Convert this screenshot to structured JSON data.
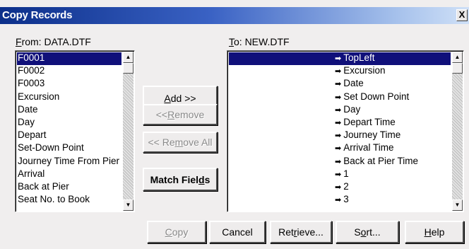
{
  "window": {
    "title": "Copy Records",
    "close_glyph": "X"
  },
  "from": {
    "label_prefix": "",
    "label_mnemonic": "F",
    "label_rest": "rom: DATA.DTF",
    "items": [
      "F0001",
      "F0002",
      "F0003",
      "Excursion",
      "Date",
      "Day",
      "Depart",
      "Set-Down Point",
      "Journey Time From Pier",
      "Arrival",
      "Back at Pier",
      "Seat No. to Book"
    ]
  },
  "to": {
    "label_prefix": "",
    "label_mnemonic": "T",
    "label_rest": "o: NEW.DTF",
    "arrow": "➡",
    "items": [
      "TopLeft",
      "Excursion",
      "Date",
      "Set Down Point",
      "Day",
      "Depart Time",
      "Journey Time",
      "Arrival Time",
      "Back at Pier Time",
      "1",
      "2",
      "3"
    ]
  },
  "scroll": {
    "up": "▲",
    "down": "▼"
  },
  "buttons": {
    "add": {
      "pre": "",
      "mn": "A",
      "post": "dd >>"
    },
    "remove": {
      "pre": "<< ",
      "mn": "R",
      "post": "emove"
    },
    "remove_all": {
      "pre": "<< Re",
      "mn": "m",
      "post": "ove All"
    },
    "match_fields": {
      "pre": "Match Fiel",
      "mn": "d",
      "post": "s"
    },
    "copy": {
      "pre": "",
      "mn": "C",
      "post": "opy"
    },
    "cancel": {
      "pre": "Cancel",
      "mn": "",
      "post": ""
    },
    "retrieve": {
      "pre": "Ret",
      "mn": "r",
      "post": "ieve..."
    },
    "sort": {
      "pre": "S",
      "mn": "o",
      "post": "rt..."
    },
    "help": {
      "pre": "",
      "mn": "H",
      "post": "elp"
    }
  }
}
